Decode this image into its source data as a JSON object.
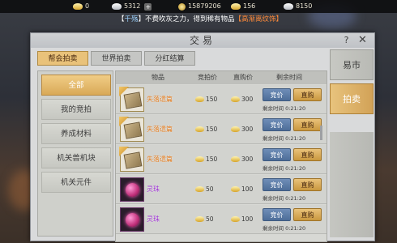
{
  "topbar": {
    "gold_ingot": "0",
    "silver_ingot": "5312",
    "coins": "15879206",
    "bound_ingot": "156",
    "silver": "8150",
    "plus": "+"
  },
  "broadcast": {
    "prefix": "【",
    "name": "千殇",
    "text": "】不费吹灰之力，得到稀有物品",
    "item": "【高渐离纹饰】"
  },
  "window": {
    "title": "交易",
    "help": "?",
    "close": "✕"
  },
  "tabs": [
    {
      "label": "帮会拍卖",
      "active": true
    },
    {
      "label": "世界拍卖",
      "active": false
    },
    {
      "label": "分红结算",
      "active": false
    }
  ],
  "menu": [
    {
      "label": "全部",
      "active": true
    },
    {
      "label": "我的竞拍",
      "active": false
    },
    {
      "label": "养成材料",
      "active": false
    },
    {
      "label": "机关兽机块",
      "active": false
    },
    {
      "label": "机关元件",
      "active": false
    }
  ],
  "list": {
    "headers": {
      "item": "物品",
      "bid": "竞拍价",
      "buy": "直购价",
      "time": "剩余时间"
    },
    "bid_label": "竞价",
    "buy_label": "直购",
    "rows": [
      {
        "icon": "book",
        "name": "失落遗篇",
        "bid": "150",
        "buy": "300",
        "remain": "剩余时间 0:21:20"
      },
      {
        "icon": "book",
        "name": "失落遗篇",
        "bid": "150",
        "buy": "300",
        "remain": "剩余时间 0:21:20"
      },
      {
        "icon": "book",
        "name": "失落遗篇",
        "bid": "150",
        "buy": "300",
        "remain": "剩余时间 0:21:20"
      },
      {
        "icon": "orb",
        "name": "灵珠",
        "bid": "50",
        "buy": "100",
        "remain": "剩余时间 0:21:20"
      },
      {
        "icon": "orb",
        "name": "灵珠",
        "bid": "50",
        "buy": "100",
        "remain": "剩余时间 0:21:20"
      }
    ]
  },
  "side_tabs": [
    {
      "label": "易市",
      "active": false
    },
    {
      "label": "拍卖",
      "active": true
    }
  ],
  "colors": {
    "accent_gold": "#e9c27a",
    "bid_blue": "#5a7aa6",
    "item_orange": "#e07b1f",
    "item_purple": "#9b2fd0"
  }
}
